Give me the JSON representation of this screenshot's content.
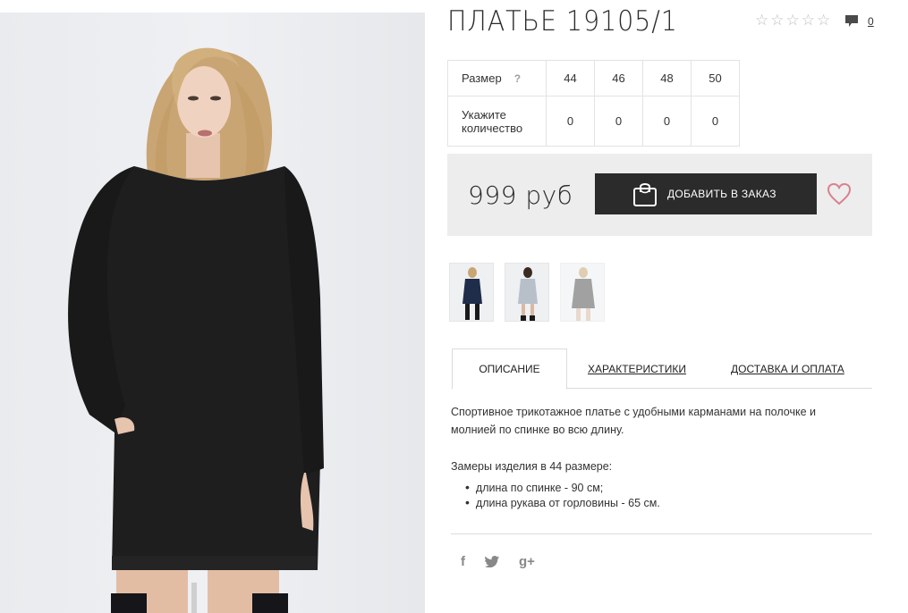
{
  "product": {
    "title": "ПЛАТЬЕ 19105/1",
    "rating_stars": 5,
    "rating_value": 0,
    "comment_count": "0"
  },
  "sizes": {
    "size_label": "Размер",
    "help_mark": "?",
    "quantity_label": "Укажите количество",
    "columns": [
      {
        "size": "44",
        "qty": "0"
      },
      {
        "size": "46",
        "qty": "0"
      },
      {
        "size": "48",
        "qty": "0"
      },
      {
        "size": "50",
        "qty": "0"
      }
    ]
  },
  "buy": {
    "price": "999 руб",
    "add_button": "ДОБАВИТЬ В ЗАКАЗ"
  },
  "tabs": [
    {
      "label": "ОПИСАНИЕ",
      "active": true
    },
    {
      "label": "ХАРАКТЕРИСТИКИ",
      "active": false
    },
    {
      "label": "ДОСТАВКА И ОПЛАТА",
      "active": false
    }
  ],
  "description": {
    "text": "Спортивное трикотажное платье с удобными карманами на полочке и молнией по спинке во всю длину.",
    "measure_title": "Замеры изделия в 44 размере:",
    "measures": [
      "длина по спинке - 90 см;",
      "длина рукава от горловины - 65 см."
    ]
  },
  "social": {
    "facebook": "f",
    "twitter": "twitter-icon",
    "google": "g+"
  },
  "colors": {
    "button_bg": "#2b2b2b",
    "buy_box_bg": "#ededed",
    "heart": "#d9818f"
  }
}
